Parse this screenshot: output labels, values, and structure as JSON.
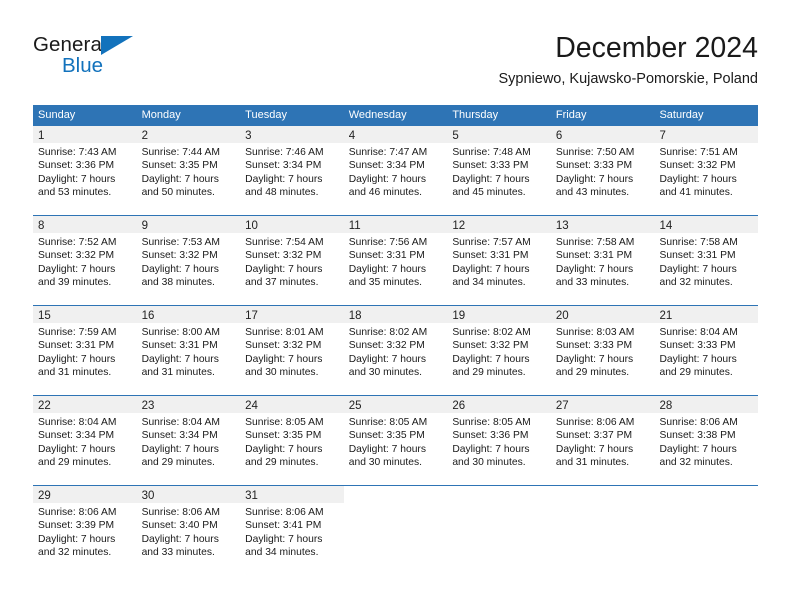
{
  "brand": {
    "word_top": "General",
    "word_bottom": "Blue",
    "accent_color": "#1272bc",
    "triangle_icon": "triangle-logo-icon"
  },
  "header": {
    "title": "December 2024",
    "subtitle": "Sypniewo, Kujawsko-Pomorskie, Poland"
  },
  "calendar": {
    "header_bg": "#2e74b5",
    "daynum_bg": "#f0f0f0",
    "weekdays": [
      "Sunday",
      "Monday",
      "Tuesday",
      "Wednesday",
      "Thursday",
      "Friday",
      "Saturday"
    ],
    "weeks": [
      [
        {
          "day": "1",
          "sunrise": "Sunrise: 7:43 AM",
          "sunset": "Sunset: 3:36 PM",
          "daylight_1": "Daylight: 7 hours",
          "daylight_2": "and 53 minutes."
        },
        {
          "day": "2",
          "sunrise": "Sunrise: 7:44 AM",
          "sunset": "Sunset: 3:35 PM",
          "daylight_1": "Daylight: 7 hours",
          "daylight_2": "and 50 minutes."
        },
        {
          "day": "3",
          "sunrise": "Sunrise: 7:46 AM",
          "sunset": "Sunset: 3:34 PM",
          "daylight_1": "Daylight: 7 hours",
          "daylight_2": "and 48 minutes."
        },
        {
          "day": "4",
          "sunrise": "Sunrise: 7:47 AM",
          "sunset": "Sunset: 3:34 PM",
          "daylight_1": "Daylight: 7 hours",
          "daylight_2": "and 46 minutes."
        },
        {
          "day": "5",
          "sunrise": "Sunrise: 7:48 AM",
          "sunset": "Sunset: 3:33 PM",
          "daylight_1": "Daylight: 7 hours",
          "daylight_2": "and 45 minutes."
        },
        {
          "day": "6",
          "sunrise": "Sunrise: 7:50 AM",
          "sunset": "Sunset: 3:33 PM",
          "daylight_1": "Daylight: 7 hours",
          "daylight_2": "and 43 minutes."
        },
        {
          "day": "7",
          "sunrise": "Sunrise: 7:51 AM",
          "sunset": "Sunset: 3:32 PM",
          "daylight_1": "Daylight: 7 hours",
          "daylight_2": "and 41 minutes."
        }
      ],
      [
        {
          "day": "8",
          "sunrise": "Sunrise: 7:52 AM",
          "sunset": "Sunset: 3:32 PM",
          "daylight_1": "Daylight: 7 hours",
          "daylight_2": "and 39 minutes."
        },
        {
          "day": "9",
          "sunrise": "Sunrise: 7:53 AM",
          "sunset": "Sunset: 3:32 PM",
          "daylight_1": "Daylight: 7 hours",
          "daylight_2": "and 38 minutes."
        },
        {
          "day": "10",
          "sunrise": "Sunrise: 7:54 AM",
          "sunset": "Sunset: 3:32 PM",
          "daylight_1": "Daylight: 7 hours",
          "daylight_2": "and 37 minutes."
        },
        {
          "day": "11",
          "sunrise": "Sunrise: 7:56 AM",
          "sunset": "Sunset: 3:31 PM",
          "daylight_1": "Daylight: 7 hours",
          "daylight_2": "and 35 minutes."
        },
        {
          "day": "12",
          "sunrise": "Sunrise: 7:57 AM",
          "sunset": "Sunset: 3:31 PM",
          "daylight_1": "Daylight: 7 hours",
          "daylight_2": "and 34 minutes."
        },
        {
          "day": "13",
          "sunrise": "Sunrise: 7:58 AM",
          "sunset": "Sunset: 3:31 PM",
          "daylight_1": "Daylight: 7 hours",
          "daylight_2": "and 33 minutes."
        },
        {
          "day": "14",
          "sunrise": "Sunrise: 7:58 AM",
          "sunset": "Sunset: 3:31 PM",
          "daylight_1": "Daylight: 7 hours",
          "daylight_2": "and 32 minutes."
        }
      ],
      [
        {
          "day": "15",
          "sunrise": "Sunrise: 7:59 AM",
          "sunset": "Sunset: 3:31 PM",
          "daylight_1": "Daylight: 7 hours",
          "daylight_2": "and 31 minutes."
        },
        {
          "day": "16",
          "sunrise": "Sunrise: 8:00 AM",
          "sunset": "Sunset: 3:31 PM",
          "daylight_1": "Daylight: 7 hours",
          "daylight_2": "and 31 minutes."
        },
        {
          "day": "17",
          "sunrise": "Sunrise: 8:01 AM",
          "sunset": "Sunset: 3:32 PM",
          "daylight_1": "Daylight: 7 hours",
          "daylight_2": "and 30 minutes."
        },
        {
          "day": "18",
          "sunrise": "Sunrise: 8:02 AM",
          "sunset": "Sunset: 3:32 PM",
          "daylight_1": "Daylight: 7 hours",
          "daylight_2": "and 30 minutes."
        },
        {
          "day": "19",
          "sunrise": "Sunrise: 8:02 AM",
          "sunset": "Sunset: 3:32 PM",
          "daylight_1": "Daylight: 7 hours",
          "daylight_2": "and 29 minutes."
        },
        {
          "day": "20",
          "sunrise": "Sunrise: 8:03 AM",
          "sunset": "Sunset: 3:33 PM",
          "daylight_1": "Daylight: 7 hours",
          "daylight_2": "and 29 minutes."
        },
        {
          "day": "21",
          "sunrise": "Sunrise: 8:04 AM",
          "sunset": "Sunset: 3:33 PM",
          "daylight_1": "Daylight: 7 hours",
          "daylight_2": "and 29 minutes."
        }
      ],
      [
        {
          "day": "22",
          "sunrise": "Sunrise: 8:04 AM",
          "sunset": "Sunset: 3:34 PM",
          "daylight_1": "Daylight: 7 hours",
          "daylight_2": "and 29 minutes."
        },
        {
          "day": "23",
          "sunrise": "Sunrise: 8:04 AM",
          "sunset": "Sunset: 3:34 PM",
          "daylight_1": "Daylight: 7 hours",
          "daylight_2": "and 29 minutes."
        },
        {
          "day": "24",
          "sunrise": "Sunrise: 8:05 AM",
          "sunset": "Sunset: 3:35 PM",
          "daylight_1": "Daylight: 7 hours",
          "daylight_2": "and 29 minutes."
        },
        {
          "day": "25",
          "sunrise": "Sunrise: 8:05 AM",
          "sunset": "Sunset: 3:35 PM",
          "daylight_1": "Daylight: 7 hours",
          "daylight_2": "and 30 minutes."
        },
        {
          "day": "26",
          "sunrise": "Sunrise: 8:05 AM",
          "sunset": "Sunset: 3:36 PM",
          "daylight_1": "Daylight: 7 hours",
          "daylight_2": "and 30 minutes."
        },
        {
          "day": "27",
          "sunrise": "Sunrise: 8:06 AM",
          "sunset": "Sunset: 3:37 PM",
          "daylight_1": "Daylight: 7 hours",
          "daylight_2": "and 31 minutes."
        },
        {
          "day": "28",
          "sunrise": "Sunrise: 8:06 AM",
          "sunset": "Sunset: 3:38 PM",
          "daylight_1": "Daylight: 7 hours",
          "daylight_2": "and 32 minutes."
        }
      ],
      [
        {
          "day": "29",
          "sunrise": "Sunrise: 8:06 AM",
          "sunset": "Sunset: 3:39 PM",
          "daylight_1": "Daylight: 7 hours",
          "daylight_2": "and 32 minutes."
        },
        {
          "day": "30",
          "sunrise": "Sunrise: 8:06 AM",
          "sunset": "Sunset: 3:40 PM",
          "daylight_1": "Daylight: 7 hours",
          "daylight_2": "and 33 minutes."
        },
        {
          "day": "31",
          "sunrise": "Sunrise: 8:06 AM",
          "sunset": "Sunset: 3:41 PM",
          "daylight_1": "Daylight: 7 hours",
          "daylight_2": "and 34 minutes."
        },
        {
          "day": "",
          "sunrise": "",
          "sunset": "",
          "daylight_1": "",
          "daylight_2": ""
        },
        {
          "day": "",
          "sunrise": "",
          "sunset": "",
          "daylight_1": "",
          "daylight_2": ""
        },
        {
          "day": "",
          "sunrise": "",
          "sunset": "",
          "daylight_1": "",
          "daylight_2": ""
        },
        {
          "day": "",
          "sunrise": "",
          "sunset": "",
          "daylight_1": "",
          "daylight_2": ""
        }
      ]
    ]
  }
}
